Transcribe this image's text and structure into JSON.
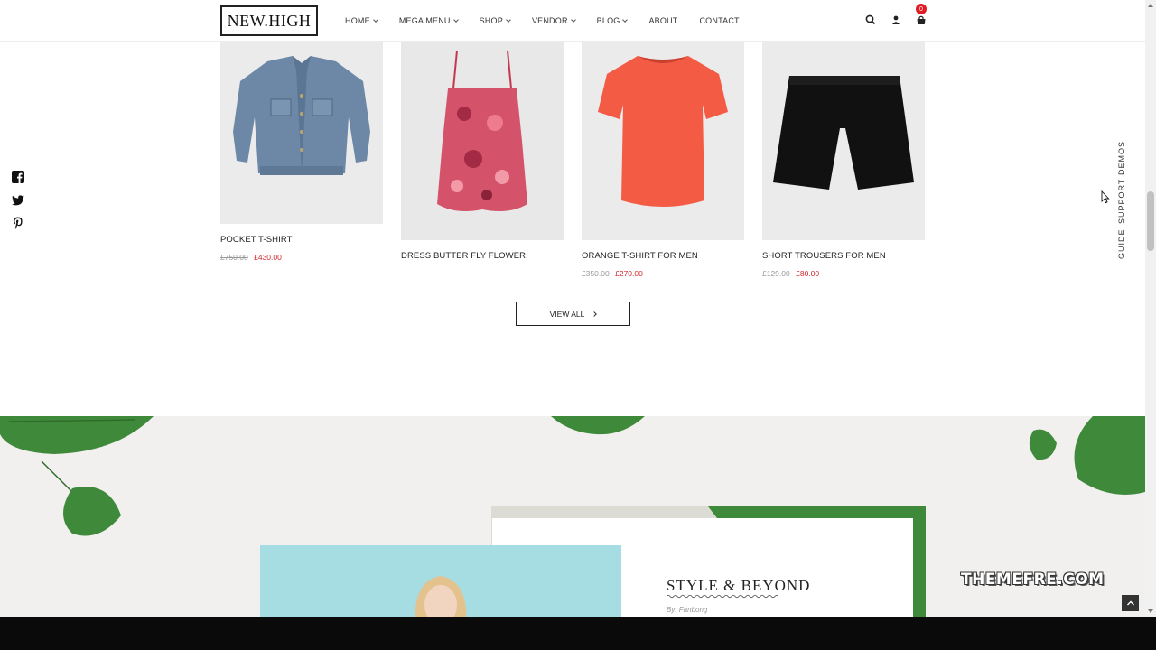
{
  "header": {
    "logo": "NEW.HIGH",
    "nav": [
      {
        "label": "HOME",
        "dropdown": true
      },
      {
        "label": "MEGA MENU",
        "dropdown": true
      },
      {
        "label": "SHOP",
        "dropdown": true
      },
      {
        "label": "VENDOR",
        "dropdown": true
      },
      {
        "label": "BLOG",
        "dropdown": true
      },
      {
        "label": "ABOUT",
        "dropdown": false
      },
      {
        "label": "CONTACT",
        "dropdown": false
      }
    ],
    "cart_count": "0"
  },
  "side_links": [
    "DEMOS",
    "SUPPORT",
    "GUIDE"
  ],
  "social": [
    "facebook-icon",
    "twitter-icon",
    "pinterest-icon"
  ],
  "products": [
    {
      "name": "POCKET T-SHIRT",
      "old_price": "£750.00",
      "price": "£430.00"
    },
    {
      "name": "DRESS BUTTER FLY FLOWER",
      "old_price": "",
      "price": ""
    },
    {
      "name": "ORANGE T-SHIRT FOR MEN",
      "old_price": "£350.00",
      "price": "£270.00"
    },
    {
      "name": "SHORT TROUSERS FOR MEN",
      "old_price": "£129.00",
      "price": "£80.00"
    }
  ],
  "view_all_label": "VIEW ALL",
  "blog": {
    "title": "STYLE & BEYOND",
    "author": "By: Fanbong"
  },
  "watermark": "THEMEFRE.COM",
  "colors": {
    "accent_price": "#d0282e",
    "badge": "#e01b24",
    "photo_bg": "#a5dde3"
  }
}
